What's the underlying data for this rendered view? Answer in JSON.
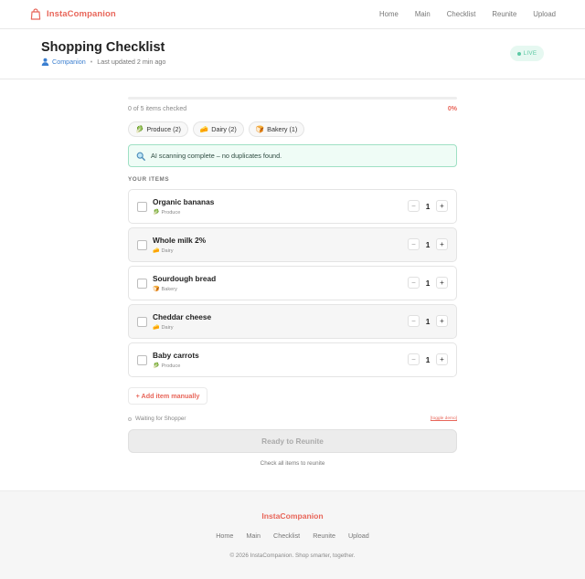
{
  "brand": {
    "name": "InstaCompanion",
    "color": "#e8665a"
  },
  "nav": {
    "links": [
      "Home",
      "Main",
      "Checklist",
      "Reunite",
      "Upload"
    ]
  },
  "header": {
    "title": "Shopping Checklist",
    "user": "Companion",
    "updated": "Last updated 2 min ago",
    "live_label": "LIVE"
  },
  "progress": {
    "text": "0 of 5 items checked",
    "percent_label": "0%",
    "fraction": 0
  },
  "chips": [
    {
      "icon": "🥬",
      "label": "Produce (2)"
    },
    {
      "icon": "🧀",
      "label": "Dairy (2)"
    },
    {
      "icon": "🍞",
      "label": "Bakery (1)"
    }
  ],
  "scan": {
    "text": "AI scanning complete – no duplicates found."
  },
  "section_label": "YOUR ITEMS",
  "items": [
    {
      "name": "Organic bananas",
      "category_icon": "🥬",
      "category": "Produce",
      "qty": "1"
    },
    {
      "name": "Whole milk 2%",
      "category_icon": "🧀",
      "category": "Dairy",
      "qty": "1"
    },
    {
      "name": "Sourdough bread",
      "category_icon": "🍞",
      "category": "Bakery",
      "qty": "1"
    },
    {
      "name": "Cheddar cheese",
      "category_icon": "🧀",
      "category": "Dairy",
      "qty": "1"
    },
    {
      "name": "Baby carrots",
      "category_icon": "🥬",
      "category": "Produce",
      "qty": "1"
    }
  ],
  "stepper": {
    "minus": "−",
    "plus": "+"
  },
  "add_label": "+ Add item manually",
  "waiting_text": "Waiting for Shopper",
  "toggle_demo": "[toggle demo]",
  "ready_label": "Ready to Reunite",
  "ready_hint": "Check all items to reunite",
  "footer": {
    "brand": "InstaCompanion",
    "links": [
      "Home",
      "Main",
      "Checklist",
      "Reunite",
      "Upload"
    ],
    "copyright": "© 2026 InstaCompanion. Shop smarter, together."
  }
}
